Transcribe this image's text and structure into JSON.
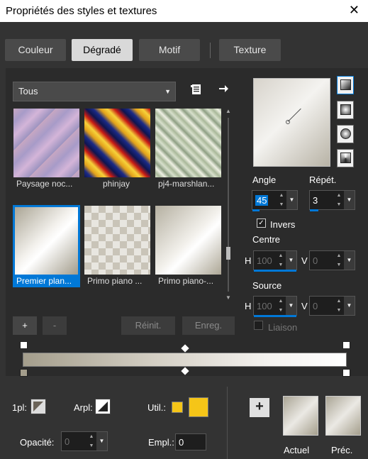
{
  "window": {
    "title": "Propriétés des styles et textures",
    "close_glyph": "✕"
  },
  "tabs": [
    {
      "label": "Couleur",
      "active": false
    },
    {
      "label": "Dégradé",
      "active": true
    },
    {
      "label": "Motif",
      "active": false
    },
    {
      "label": "Texture",
      "active": false
    }
  ],
  "gallery": {
    "category": "Tous",
    "items": [
      {
        "label": "Paysage noc...",
        "selected": false
      },
      {
        "label": "phinjay",
        "selected": false
      },
      {
        "label": "pj4-marshlan...",
        "selected": false
      },
      {
        "label": "Premier plan...",
        "selected": true
      },
      {
        "label": "Primo piano ...",
        "selected": false
      },
      {
        "label": "Primo piano-...",
        "selected": false
      }
    ]
  },
  "actions": {
    "add": "+",
    "remove": "-",
    "reset": "Réinit.",
    "save": "Enreg."
  },
  "settings": {
    "angle_label": "Angle",
    "angle": "45",
    "repeat_label": "Répét.",
    "repeat": "3",
    "invert_label": "Invers",
    "invert_checked": true,
    "center_label": "Centre",
    "center_h_label": "H",
    "center_h": "100",
    "center_v_label": "V",
    "center_v": "0",
    "source_label": "Source",
    "source_h_label": "H",
    "source_h": "100",
    "source_v_label": "V",
    "source_v": "0",
    "link_label": "Liaison"
  },
  "bottom": {
    "fg_label": "1pl:",
    "bg_label": "Arpl:",
    "use_label": "Util.:",
    "opacity_label": "Opacité:",
    "opacity": "0",
    "location_label": "Empl.:",
    "location": "0",
    "current_label": "Actuel",
    "previous_label": "Préc.",
    "swatch_color": "#f5c518"
  }
}
